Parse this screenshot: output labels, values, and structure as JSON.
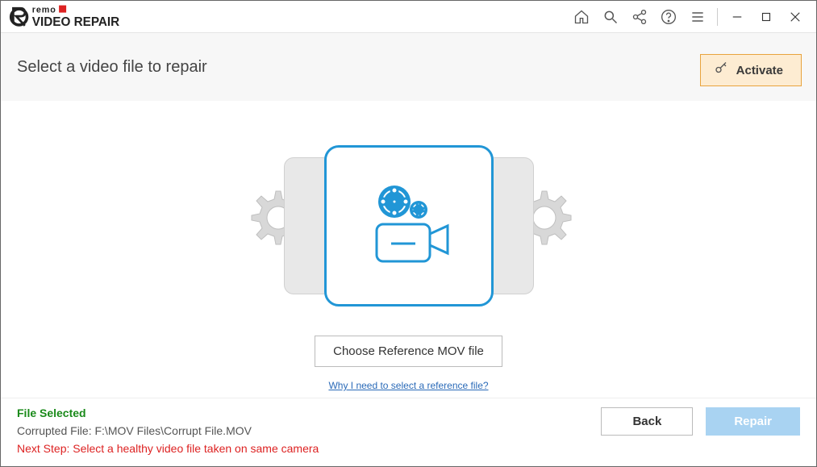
{
  "app": {
    "brand_top": "remo",
    "brand_bottom": "VIDEO REPAIR"
  },
  "titlebar": {
    "icons": {
      "home": "home-icon",
      "search": "search-icon",
      "share": "share-icon",
      "help": "help-icon",
      "menu": "menu-icon",
      "minimize": "minimize-icon",
      "maximize": "maximize-icon",
      "close": "close-icon"
    }
  },
  "subheader": {
    "title": "Select a video file to repair",
    "activate_label": "Activate"
  },
  "content": {
    "choose_button": "Choose Reference MOV file",
    "reference_link": "Why I need to select a reference file?"
  },
  "footer": {
    "selected_label": "File Selected",
    "path_label": "Corrupted File: ",
    "path_value": "F:\\MOV Files\\Corrupt File.MOV",
    "next_step": "Next Step: Select a healthy video file taken on same camera",
    "back_label": "Back",
    "repair_label": "Repair"
  }
}
